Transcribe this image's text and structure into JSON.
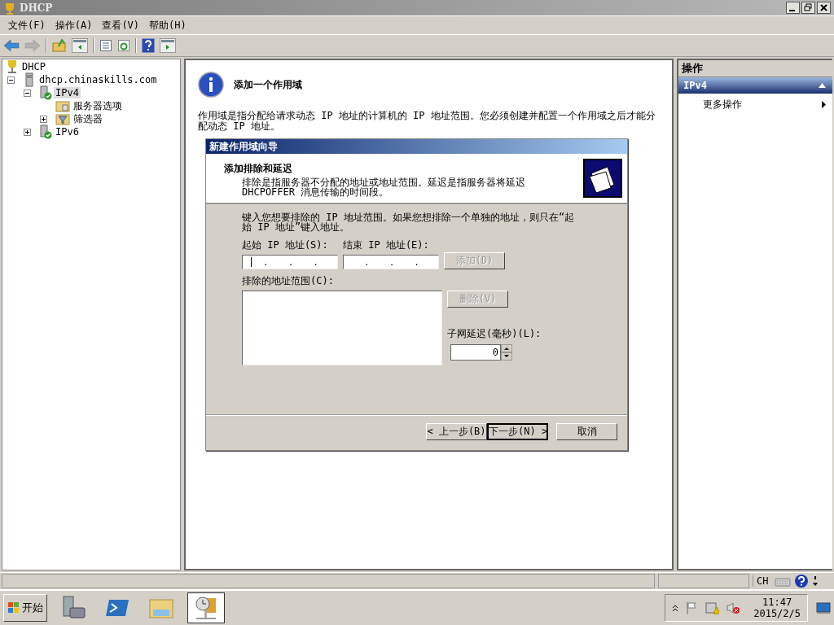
{
  "window": {
    "title": "DHCP"
  },
  "menu": [
    "文件(F)",
    "操作(A)",
    "查看(V)",
    "帮助(H)"
  ],
  "toolbar": [
    {
      "kind": "back",
      "disabled": false
    },
    {
      "kind": "forward",
      "disabled": true
    },
    {
      "kind": "sep"
    },
    {
      "kind": "up"
    },
    {
      "kind": "tree-pane"
    },
    {
      "kind": "sep"
    },
    {
      "kind": "properties"
    },
    {
      "kind": "refresh"
    },
    {
      "kind": "sep"
    },
    {
      "kind": "help"
    },
    {
      "kind": "action-pane"
    }
  ],
  "tree": [
    {
      "label": "DHCP",
      "kind": "root",
      "selected": false,
      "children": [
        {
          "label": "dhcp.chinaskills.com",
          "kind": "server",
          "expanded": true,
          "selected": false,
          "children": [
            {
              "label": "IPv4",
              "kind": "ip",
              "expanded": true,
              "selected": true,
              "children": [
                {
                  "label": "服务器选项",
                  "kind": "options",
                  "selected": false
                },
                {
                  "label": "筛选器",
                  "kind": "filter",
                  "expanded": false,
                  "selected": false
                }
              ]
            },
            {
              "label": "IPv6",
              "kind": "ip",
              "expanded": false,
              "selected": false
            }
          ]
        }
      ]
    }
  ],
  "intro": {
    "heading": "添加一个作用域",
    "text": "作用域是指分配给请求动态 IP 地址的计算机的 IP 地址范围。您必须创建并配置一个作用域之后才能分配动态 IP 地址。"
  },
  "actions": {
    "title": "操作",
    "sections": [
      {
        "label": "IPv4",
        "expanded": true,
        "items": [
          {
            "label": "更多操作",
            "submenu": true
          }
        ]
      }
    ]
  },
  "dialog": {
    "title": "新建作用域向导",
    "header": {
      "title": "添加排除和延迟",
      "text_lines": [
        "排除是指服务器不分配的地址或地址范围。延迟是指服务器将延迟",
        "DHCPOFFER 消息传输的时间段。"
      ]
    },
    "instructions": "键入您想要排除的 IP 地址范围。如果您想排除一个单独的地址，则只在“起始 IP 地址”键入地址。",
    "start_ip": {
      "label": "起始 IP 地址(S):",
      "focused": true,
      "separators": [
        ".",
        ".",
        "."
      ]
    },
    "end_ip": {
      "label": "结束 IP 地址(E):",
      "focused": false,
      "separators": [
        ".",
        ".",
        "."
      ]
    },
    "add_button": {
      "label": "添加(D)",
      "disabled": true
    },
    "excluded": {
      "label": "排除的地址范围(C):"
    },
    "remove_button": {
      "label": "删除(V)",
      "disabled": true
    },
    "delay": {
      "label": "子网延迟(毫秒)(L):",
      "value": "0"
    },
    "buttons": [
      {
        "label": "< 上一步(B)",
        "default": false
      },
      {
        "label": "下一步(N) >",
        "default": true
      },
      {
        "label": "取消",
        "default": false
      }
    ]
  },
  "status_bar": {
    "language": "CH"
  },
  "taskbar": {
    "start": "开始",
    "apps": [
      {
        "kind": "server-manager",
        "selected": false
      },
      {
        "kind": "powershell",
        "selected": false
      },
      {
        "kind": "explorer",
        "selected": false
      },
      {
        "kind": "dhcp",
        "selected": true
      }
    ],
    "clock": {
      "time": "11:47",
      "date": "2015/2/5"
    }
  }
}
